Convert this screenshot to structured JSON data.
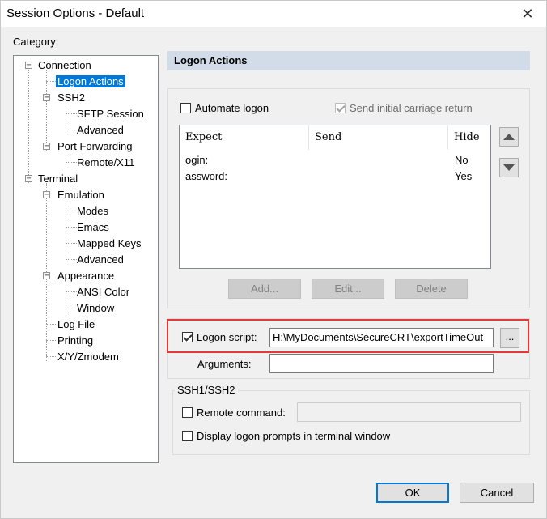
{
  "window": {
    "title": "Session Options - Default",
    "close_glyph": "✕"
  },
  "category": {
    "label": "Category:",
    "tree": [
      {
        "label": "Connection",
        "expander": "−"
      },
      {
        "label": "Logon Actions",
        "selected": true
      },
      {
        "label": "SSH2",
        "expander": "−"
      },
      {
        "label": "SFTP Session"
      },
      {
        "label": "Advanced"
      },
      {
        "label": "Port Forwarding",
        "expander": "−"
      },
      {
        "label": "Remote/X11"
      },
      {
        "label": "Terminal",
        "expander": "−"
      },
      {
        "label": "Emulation",
        "expander": "−"
      },
      {
        "label": "Modes"
      },
      {
        "label": "Emacs"
      },
      {
        "label": "Mapped Keys"
      },
      {
        "label": "Advanced"
      },
      {
        "label": "Appearance",
        "expander": "−"
      },
      {
        "label": "ANSI Color"
      },
      {
        "label": "Window"
      },
      {
        "label": "Log File"
      },
      {
        "label": "Printing"
      },
      {
        "label": "X/Y/Zmodem"
      }
    ]
  },
  "panel": {
    "title": "Logon Actions",
    "automate_logon": {
      "label": "Automate logon",
      "checked": false
    },
    "send_initial_cr": {
      "label": "Send initial carriage return",
      "checked": true,
      "disabled": true
    },
    "table": {
      "columns": [
        "Expect",
        "Send",
        "Hide"
      ],
      "rows": [
        {
          "expect": "ogin:",
          "send": "",
          "hide": "No"
        },
        {
          "expect": "assword:",
          "send": "",
          "hide": "Yes"
        }
      ]
    },
    "move_up_icon": "triangle-up-icon",
    "move_down_icon": "triangle-down-icon",
    "buttons": {
      "add": "Add...",
      "edit": "Edit...",
      "delete": "Delete"
    },
    "logon_script": {
      "label": "Logon script:",
      "checked": true,
      "value": "H:\\MyDocuments\\SecureCRT\\exportTimeOut",
      "browse": "..."
    },
    "arguments": {
      "label": "Arguments:",
      "value": ""
    },
    "ssh_group": {
      "caption": "SSH1/SSH2",
      "remote_command": {
        "label": "Remote command:",
        "checked": false,
        "value": ""
      },
      "display_prompts": {
        "label": "Display logon prompts in terminal window",
        "checked": false
      }
    }
  },
  "footer": {
    "ok": "OK",
    "cancel": "Cancel"
  },
  "colors": {
    "selection": "#0078d7",
    "header_band": "#d2dce8",
    "highlight_box": "#e53935"
  }
}
